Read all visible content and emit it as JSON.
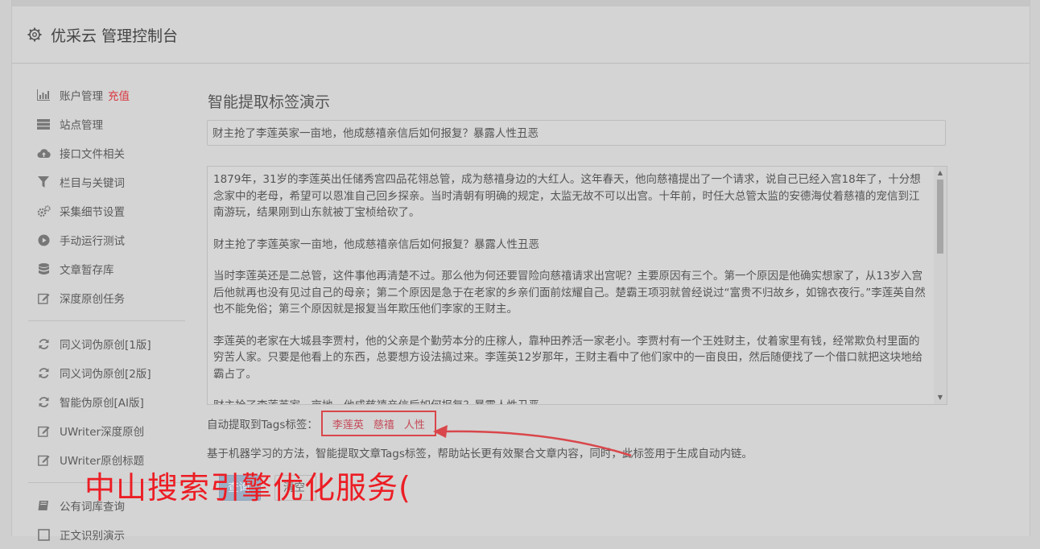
{
  "header": {
    "title": "优采云 管理控制台"
  },
  "sidebar": {
    "items": [
      {
        "label": "账户管理",
        "badge": "充值",
        "icon": "bar-chart-icon"
      },
      {
        "label": "站点管理",
        "icon": "server-icon"
      },
      {
        "label": "接口文件相关",
        "icon": "cloud-upload-icon"
      },
      {
        "label": "栏目与关键词",
        "icon": "filter-icon"
      },
      {
        "label": "采集细节设置",
        "icon": "cogs-icon"
      },
      {
        "label": "手动运行测试",
        "icon": "play-circle-icon"
      },
      {
        "label": "文章暂存库",
        "icon": "database-icon"
      },
      {
        "label": "深度原创任务",
        "icon": "edit-icon"
      }
    ],
    "items2": [
      {
        "label": "同义词伪原创[1版]",
        "icon": "refresh-icon"
      },
      {
        "label": "同义词伪原创[2版]",
        "icon": "refresh-icon"
      },
      {
        "label": "智能伪原创[AI版]",
        "icon": "refresh-icon"
      },
      {
        "label": "UWriter深度原创",
        "icon": "edit-icon"
      },
      {
        "label": "UWriter原创标题",
        "icon": "edit-icon"
      }
    ],
    "items3": [
      {
        "label": "公有词库查询",
        "icon": "book-icon"
      },
      {
        "label": "正文识别演示",
        "icon": "square-icon"
      }
    ]
  },
  "main": {
    "title": "智能提取标签演示",
    "title_input": "财主抢了李莲英家一亩地，他成慈禧亲信后如何报复？暴露人性丑恶",
    "paragraphs": [
      "1879年，31岁的李莲英出任储秀宫四品花翎总管，成为慈禧身边的大红人。这年春天，他向慈禧提出了一个请求，说自己已经入宫18年了，十分想念家中的老母，希望可以恩准自己回乡探亲。当时清朝有明确的规定，太监无故不可以出宫。十年前，时任大总管太监的安德海仗着慈禧的宠信到江南游玩，结果刚到山东就被丁宝桢给砍了。",
      "财主抢了李莲英家一亩地，他成慈禧亲信后如何报复？暴露人性丑恶",
      "当时李莲英还是二总管，这件事他再清楚不过。那么他为何还要冒险向慈禧请求出宫呢？主要原因有三个。第一个原因是他确实想家了，从13岁入宫后他就再也没有见过自己的母亲；第二个原因是急于在老家的乡亲们面前炫耀自己。楚霸王项羽就曾经说过“富贵不归故乡，如锦衣夜行。”李莲英自然也不能免俗；第三个原因就是报复当年欺压他们李家的王财主。",
      "李莲英的老家在大城县李贾村，他的父亲是个勤劳本分的庄稼人，靠种田养活一家老小。李贾村有一个王姓财主，仗着家里有钱，经常欺负村里面的穷苦人家。只要是他看上的东西，总要想方设法搞过来。李莲英12岁那年，王财主看中了他们家中的一亩良田，然后随便找了一个借口就把这块地给霸占了。",
      "财主抢了李莲英家一亩地，他成慈禧亲信后如何报复？暴露人性丑恶"
    ],
    "tags_label": "自动提取到Tags标签：",
    "tags": [
      "李莲英",
      "慈禧",
      "人性"
    ],
    "description": "基于机器学习的方法，智能提取文章Tags标签，帮助站长更有效聚合文章内容，同时，此标签用于生成自动内链。",
    "btn_primary": "查询",
    "btn_default": "清空"
  },
  "overlay_text": "中山搜索引擎优化服务(",
  "colors": {
    "tag_border": "#d9474b",
    "overlay": "#ec1d24",
    "badge": "#d9363e"
  }
}
